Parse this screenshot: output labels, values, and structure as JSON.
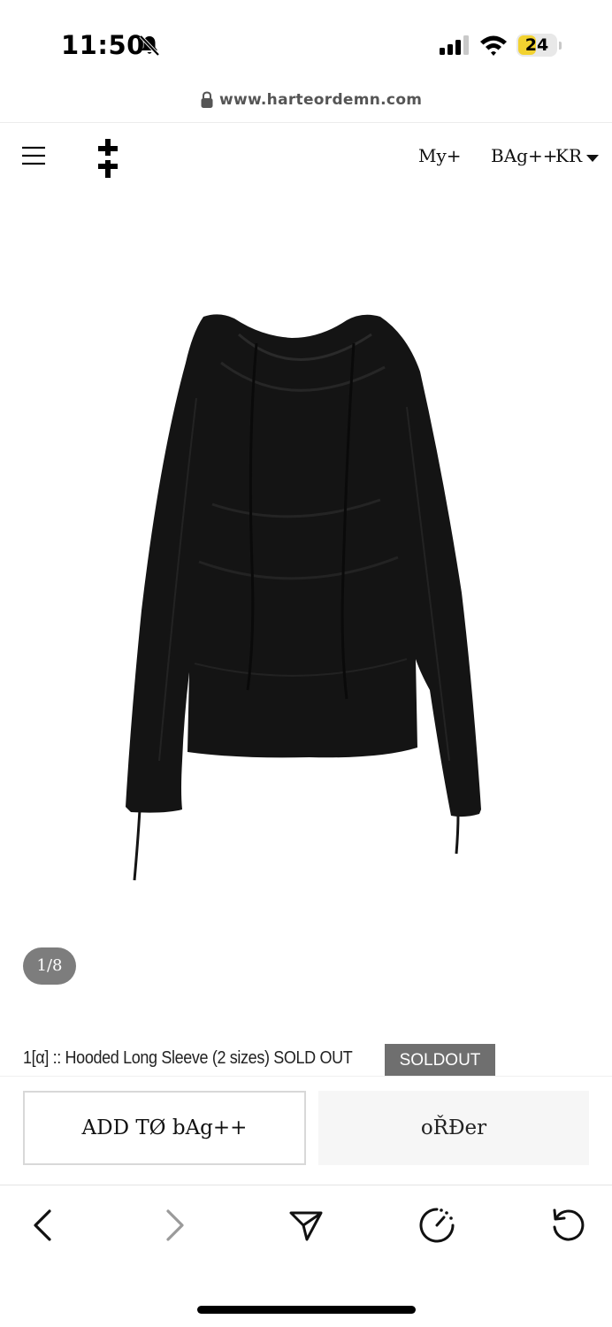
{
  "status_bar": {
    "time": "11:50",
    "battery_level": "24",
    "icons": [
      "bell-slash-icon",
      "cellular-signal-icon",
      "wifi-icon",
      "battery-icon"
    ]
  },
  "browser": {
    "url": "www.harteordemn.com"
  },
  "site_header": {
    "nav": {
      "my": "My+",
      "bag": "BAg++",
      "lang": "KR"
    },
    "icons": [
      "hamburger-menu-icon",
      "brand-logo-icon",
      "caret-down-icon"
    ]
  },
  "product": {
    "image_description_icon": "hooded-long-sleeve-image",
    "page_indicator": "1/8",
    "title": "1[α] :: Hooded Long Sleeve (2 sizes) SOLD OUT",
    "badge": "SOLDOUT"
  },
  "actions": {
    "add_to_bag": "ADD TØ bAg++",
    "order": "oŘĐer"
  },
  "toolbar": {
    "icons": [
      "back-icon",
      "forward-icon",
      "share-icon",
      "speedometer-icon",
      "reload-icon"
    ]
  },
  "colors": {
    "badge_bg": "#6f6f6f",
    "indicator_bg": "#7d7d7d",
    "battery_fill": "#f2d230",
    "garment": "#141414"
  }
}
